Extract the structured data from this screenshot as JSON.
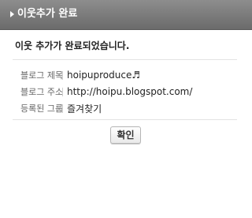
{
  "dialog": {
    "title": "이웃추가 완료",
    "message": "이웃 추가가 완료되었습니다.",
    "rows": [
      {
        "label": "블로그 제목",
        "value": "hoipuproduce♬"
      },
      {
        "label": "블로그 주소",
        "value": "http://hoipu.blogspot.com/"
      },
      {
        "label": "등록된 그룹",
        "value": "즐겨찾기"
      }
    ],
    "confirm_label": "확인"
  }
}
